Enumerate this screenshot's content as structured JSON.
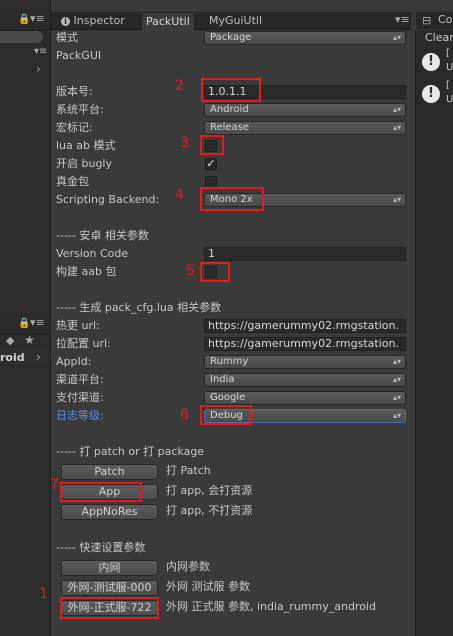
{
  "left_panel": {
    "top_icon": "lock-icon",
    "menu_icon": "menu-icon",
    "lower_icons": [
      "lock-icon",
      "menu-icon",
      "tag-icon",
      "star-icon"
    ],
    "android_item": "roid"
  },
  "tabs": {
    "inspector": "Inspector",
    "packutil": "PackUtil",
    "myguiutil": "MyGuiUtil"
  },
  "right_panel": {
    "tab_label": "Co",
    "clear_label": "Clear"
  },
  "form": {
    "mode_label": "模式",
    "mode_value": "Package",
    "packgui_label": "PackGUI",
    "version_label": "版本号:",
    "version_value": "1.0.1.1",
    "platform_label": "系统平台:",
    "platform_value": "Android",
    "macro_label": "宏标记:",
    "macro_value": "Release",
    "lua_ab_label": "lua ab 模式",
    "bugly_label": "开启 bugly",
    "bugly_checked": "✓",
    "real_pkg_label": "真金包",
    "backend_label": "Scripting Backend:",
    "backend_value": "Mono 2x",
    "android_section": "----- 安卓 相关参数",
    "version_code_label": "Version Code",
    "version_code_value": "1",
    "aab_label": "构建 aab 包",
    "cfg_section": "----- 生成 pack_cfg.lua 相关参数",
    "hot_url_label": "热更 url:",
    "hot_url_value": "https://gamerummy02.rmgstation.",
    "pull_cfg_label": "拉配置 url:",
    "pull_cfg_value": "https://gamerummy02.rmgstation.",
    "appid_label": "AppId:",
    "appid_value": "Rummy",
    "channel_label": "渠道平台:",
    "channel_value": "India",
    "pay_label": "支付渠道:",
    "pay_value": "Google",
    "log_label": "日志等级:",
    "log_value": "Debug",
    "patch_section": "----- 打 patch or 打 package",
    "patch_btn": "Patch",
    "patch_desc": "打 Patch",
    "app_btn": "App",
    "app_desc": "打 app, 会打资源",
    "appnores_btn": "AppNoRes",
    "appnores_desc": "打 app, 不打资源",
    "quick_section": "----- 快速设置参数",
    "intranet_btn": "内网",
    "intranet_desc": "内网参数",
    "test_btn": "外网-测试服-000",
    "test_desc": "外网 测试服 参数",
    "prod_btn": "外网-正式服-722",
    "prod_desc": "外网 正式服 参数, india_rummy_android"
  },
  "annotations": [
    "1",
    "2",
    "3",
    "4",
    "5",
    "6",
    "7"
  ],
  "colors": {
    "annotation_red": "#e8181b",
    "label_blue": "#5b8fe8"
  }
}
